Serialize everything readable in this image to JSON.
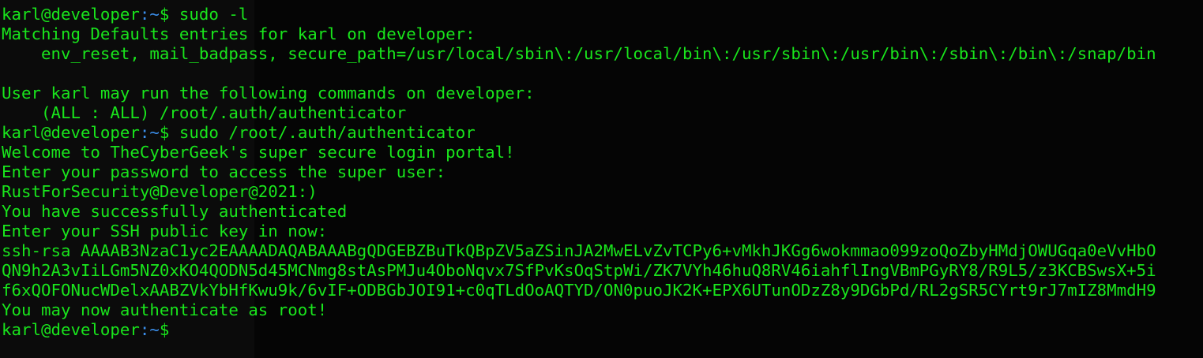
{
  "colors": {
    "background": "#000000",
    "text_green": "#19e51c",
    "prompt_path_blue": "#3b8eea"
  },
  "terminal": {
    "prompt": {
      "user_host": "karl@developer",
      "path": ":~",
      "sign": "$ "
    },
    "lines": [
      {
        "kind": "prompt",
        "command": "sudo -l"
      },
      {
        "kind": "output",
        "text": "Matching Defaults entries for karl on developer:"
      },
      {
        "kind": "output",
        "text": "    env_reset, mail_badpass, secure_path=/usr/local/sbin\\:/usr/local/bin\\:/usr/sbin\\:/usr/bin\\:/sbin\\:/bin\\:/snap/bin"
      },
      {
        "kind": "output",
        "text": ""
      },
      {
        "kind": "output",
        "text": "User karl may run the following commands on developer:"
      },
      {
        "kind": "output",
        "text": "    (ALL : ALL) /root/.auth/authenticator"
      },
      {
        "kind": "prompt",
        "command": "sudo /root/.auth/authenticator"
      },
      {
        "kind": "output",
        "text": "Welcome to TheCyberGeek's super secure login portal!"
      },
      {
        "kind": "output",
        "text": "Enter your password to access the super user:"
      },
      {
        "kind": "output",
        "text": "RustForSecurity@Developer@2021:)"
      },
      {
        "kind": "output",
        "text": "You have successfully authenticated"
      },
      {
        "kind": "output",
        "text": "Enter your SSH public key in now:"
      },
      {
        "kind": "output",
        "text": "ssh-rsa AAAAB3NzaC1yc2EAAAADAQABAAABgQDGEBZBuTkQBpZV5aZSinJA2MwELvZvTCPy6+vMkhJKGg6wokmmao099zoQoZbyHMdjOWUGqa0eVvHbO"
      },
      {
        "kind": "output",
        "text": "QN9h2A3vIiLGm5NZ0xKO4QODN5d45MCNmg8stAsPMJu4ObоNqvx7SfPvKsOqStpWi/ZK7VYh46huQ8RV46iahflIngVBmPGyRY8/R9L5/z3KCBSwsX+5i"
      },
      {
        "kind": "output",
        "text": "f6xQOFONucWDelxAABZVkYbHfKwu9k/6vIF+ODBGbJOI91+c0qTLdOoAQTYD/ON0puoJK2K+EPX6UTunODzZ8y9DGbPd/RL2gSR5CYrt9rJ7mIZ8MmdH9"
      },
      {
        "kind": "output",
        "text": "You may now authenticate as root!"
      },
      {
        "kind": "prompt",
        "command": ""
      }
    ]
  }
}
